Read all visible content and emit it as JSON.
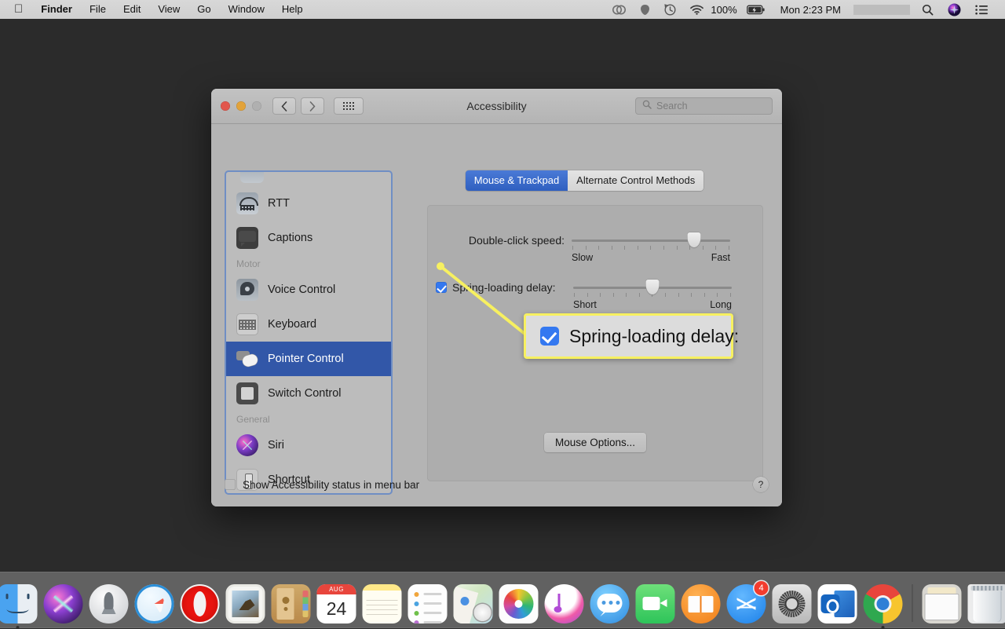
{
  "menubar": {
    "apple_icon": "apple-logo-icon",
    "items": [
      {
        "label": "Finder",
        "bold": true
      },
      {
        "label": "File",
        "bold": false
      },
      {
        "label": "Edit",
        "bold": false
      },
      {
        "label": "View",
        "bold": false
      },
      {
        "label": "Go",
        "bold": false
      },
      {
        "label": "Window",
        "bold": false
      },
      {
        "label": "Help",
        "bold": false
      }
    ],
    "status_icons": [
      "creative-cloud-icon",
      "dropbox-icon",
      "time-machine-icon",
      "wifi-icon"
    ],
    "battery_percent": "100%",
    "battery_icon": "battery-charging-icon",
    "clock": "Mon 2:23 PM",
    "right_icons": [
      "spotlight-search-icon",
      "siri-icon",
      "control-center-icon"
    ]
  },
  "window": {
    "title": "Accessibility",
    "traffic_lights": [
      "close-button",
      "minimize-button",
      "zoom-button-disabled"
    ],
    "nav": {
      "back": "‹",
      "forward": "›",
      "grid": "show-all-grid-icon"
    },
    "search": {
      "placeholder": "Search",
      "value": "",
      "icon": "search-icon"
    }
  },
  "sidebar": {
    "items": [
      {
        "label": "RTT",
        "icon": "rtt-icon",
        "type": "item",
        "selected": false
      },
      {
        "label": "Captions",
        "icon": "captions-icon",
        "type": "item",
        "selected": false
      },
      {
        "label": "Motor",
        "type": "header"
      },
      {
        "label": "Voice Control",
        "icon": "voice-control-icon",
        "type": "item",
        "selected": false
      },
      {
        "label": "Keyboard",
        "icon": "keyboard-icon",
        "type": "item",
        "selected": false
      },
      {
        "label": "Pointer Control",
        "icon": "pointer-control-icon",
        "type": "item",
        "selected": true
      },
      {
        "label": "Switch Control",
        "icon": "switch-control-icon",
        "type": "item",
        "selected": false
      },
      {
        "label": "General",
        "type": "header"
      },
      {
        "label": "Siri",
        "icon": "siri-icon",
        "type": "item",
        "selected": false
      },
      {
        "label": "Shortcut",
        "icon": "shortcut-icon",
        "type": "item",
        "selected": false
      }
    ]
  },
  "main": {
    "tabs": [
      {
        "label": "Mouse & Trackpad",
        "active": true
      },
      {
        "label": "Alternate Control Methods",
        "active": false
      }
    ],
    "double_click": {
      "label": "Double-click speed:",
      "min_label": "Slow",
      "max_label": "Fast",
      "value_percent": 77,
      "tick_count": 13
    },
    "spring_loading": {
      "label": "Spring-loading delay:",
      "checked": true,
      "min_label": "Short",
      "max_label": "Long",
      "value_percent": 50,
      "tick_count": 13
    },
    "mouse_options_button": "Mouse Options..."
  },
  "footer": {
    "show_status_label": "Show Accessibility status in menu bar",
    "show_status_checked": false,
    "help_label": "?"
  },
  "callout": {
    "text": "Spring-loading delay:",
    "checked": true,
    "border_color": "#f7f060",
    "background_color": "#dcdcdc"
  },
  "dock": {
    "items": [
      {
        "name": "finder",
        "label": "Finder",
        "running": true
      },
      {
        "name": "siri",
        "label": "Siri",
        "running": false
      },
      {
        "name": "launchpad",
        "label": "Launchpad",
        "running": false
      },
      {
        "name": "safari",
        "label": "Safari",
        "running": false
      },
      {
        "name": "opera",
        "label": "Opera",
        "running": false
      },
      {
        "name": "mail",
        "label": "Mail",
        "running": false
      },
      {
        "name": "contacts",
        "label": "Contacts",
        "running": false
      },
      {
        "name": "calendar",
        "label": "Calendar",
        "running": false,
        "month": "AUG",
        "day": "24"
      },
      {
        "name": "notes",
        "label": "Notes",
        "running": false
      },
      {
        "name": "reminders",
        "label": "Reminders",
        "running": false
      },
      {
        "name": "maps",
        "label": "Maps",
        "running": false
      },
      {
        "name": "photos",
        "label": "Photos",
        "running": false
      },
      {
        "name": "itunes",
        "label": "iTunes",
        "running": false
      },
      {
        "name": "messages",
        "label": "Messages",
        "running": false
      },
      {
        "name": "facetime",
        "label": "FaceTime",
        "running": false
      },
      {
        "name": "books",
        "label": "Books",
        "running": false
      },
      {
        "name": "app-store",
        "label": "App Store",
        "running": false,
        "badge": "4"
      },
      {
        "name": "system-preferences",
        "label": "System Preferences",
        "running": false
      },
      {
        "name": "outlook",
        "label": "Microsoft Outlook",
        "running": false
      },
      {
        "name": "chrome",
        "label": "Google Chrome",
        "running": true
      },
      {
        "name": "downloads",
        "label": "Downloads",
        "running": false
      },
      {
        "name": "trash",
        "label": "Trash",
        "running": false
      }
    ]
  },
  "desktop": {
    "background_color": "#2b2b2b"
  }
}
